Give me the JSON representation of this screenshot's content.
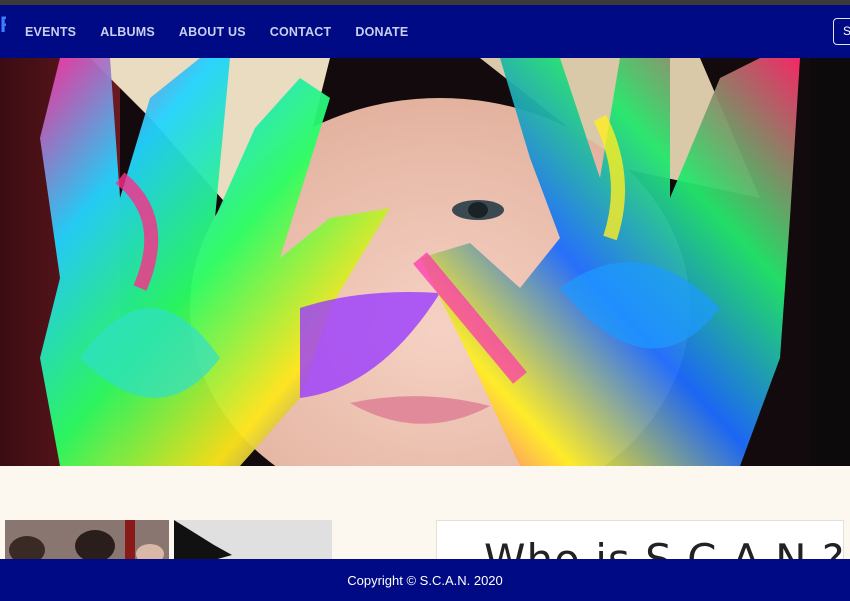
{
  "nav": {
    "links": [
      "EVENTS",
      "ALBUMS",
      "ABOUT US",
      "CONTACT",
      "DONATE"
    ],
    "button_label": "S"
  },
  "about": {
    "heading": "Who is S.C.A.N.?"
  },
  "footer": {
    "copyright": "Copyright © S.C.A.N. 2020"
  },
  "colors": {
    "navbar": "#000a85",
    "footer": "#000a85",
    "page_background": "#fdf8ef"
  },
  "icons": {
    "brand": "brand-logo-icon"
  }
}
